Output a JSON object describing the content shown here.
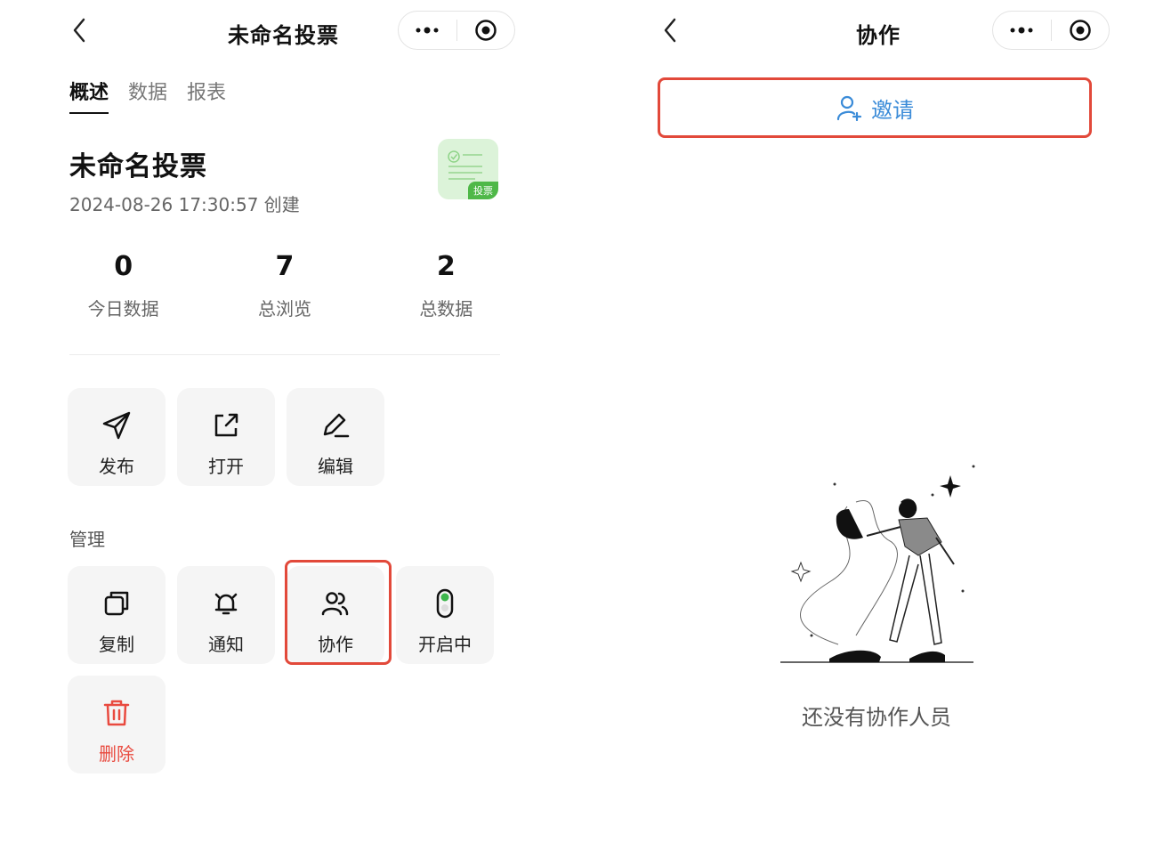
{
  "left": {
    "title": "未命名投票",
    "tabs": [
      "概述",
      "数据",
      "报表"
    ],
    "form": {
      "name": "未命名投票",
      "created": "2024-08-26 17:30:57 创建",
      "thumb_tag": "投票"
    },
    "stats": [
      {
        "value": "0",
        "label": "今日数据"
      },
      {
        "value": "7",
        "label": "总浏览"
      },
      {
        "value": "2",
        "label": "总数据"
      }
    ],
    "actions": {
      "publish": "发布",
      "open": "打开",
      "edit": "编辑"
    },
    "manage": {
      "section": "管理",
      "copy": "复制",
      "notify": "通知",
      "collab": "协作",
      "status": "开启中",
      "delete": "删除"
    }
  },
  "right": {
    "title": "协作",
    "invite": "邀请",
    "empty": "还没有协作人员"
  },
  "colors": {
    "highlight": "#e2493a",
    "invite": "#3a8bd8",
    "danger": "#e94a3f",
    "toggle_on": "#3db64d"
  }
}
